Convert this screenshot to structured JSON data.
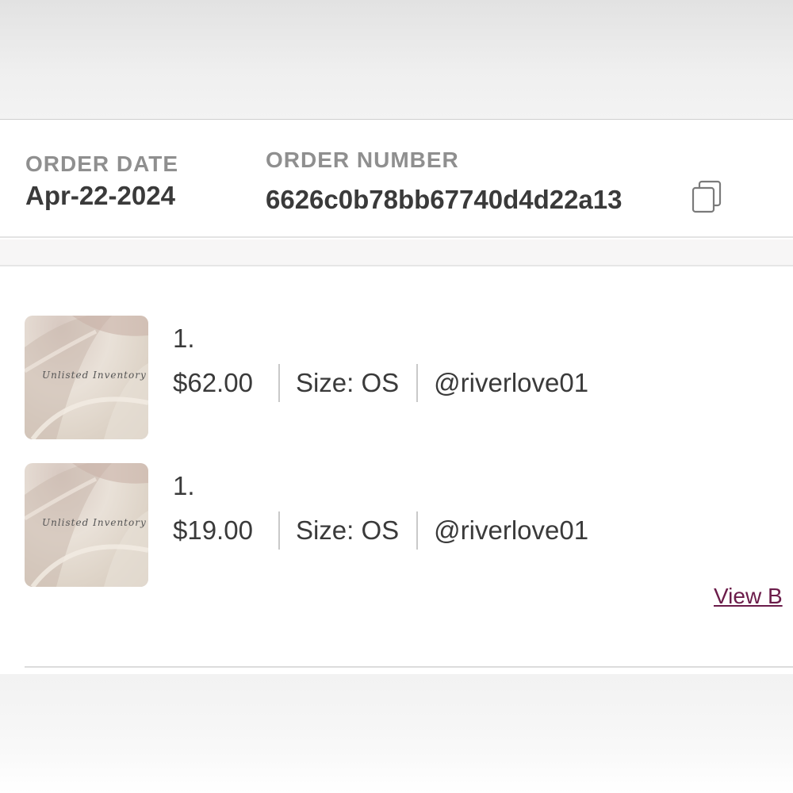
{
  "order": {
    "date_label": "ORDER DATE",
    "date_value": "Apr-22-2024",
    "number_label": "ORDER NUMBER",
    "number_value": "6626c0b78bb67740d4d22a13",
    "copy_icon": "copy-icon"
  },
  "items": [
    {
      "index": "1.",
      "price": "$62.00",
      "size": "Size: OS",
      "seller": "@riverlove01",
      "thumbnail_text": "Unlisted Inventory"
    },
    {
      "index": "1.",
      "price": "$19.00",
      "size": "Size: OS",
      "seller": "@riverlove01",
      "thumbnail_text": "Unlisted Inventory"
    }
  ],
  "footer": {
    "link_label": "View B"
  },
  "colors": {
    "label_gray": "#8f8f8f",
    "text_dark": "#3a3a3a",
    "link_maroon": "#6b1c4a"
  }
}
